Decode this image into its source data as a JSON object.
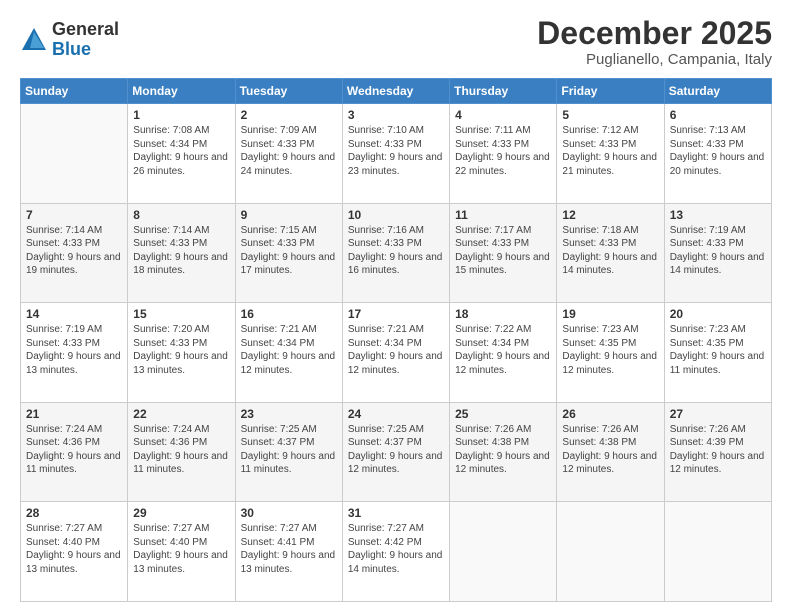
{
  "logo": {
    "general": "General",
    "blue": "Blue"
  },
  "header": {
    "month": "December 2025",
    "location": "Puglianello, Campania, Italy"
  },
  "weekdays": [
    "Sunday",
    "Monday",
    "Tuesday",
    "Wednesday",
    "Thursday",
    "Friday",
    "Saturday"
  ],
  "weeks": [
    [
      {
        "day": "",
        "sunrise": "",
        "sunset": "",
        "daylight": ""
      },
      {
        "day": "1",
        "sunrise": "Sunrise: 7:08 AM",
        "sunset": "Sunset: 4:34 PM",
        "daylight": "Daylight: 9 hours and 26 minutes."
      },
      {
        "day": "2",
        "sunrise": "Sunrise: 7:09 AM",
        "sunset": "Sunset: 4:33 PM",
        "daylight": "Daylight: 9 hours and 24 minutes."
      },
      {
        "day": "3",
        "sunrise": "Sunrise: 7:10 AM",
        "sunset": "Sunset: 4:33 PM",
        "daylight": "Daylight: 9 hours and 23 minutes."
      },
      {
        "day": "4",
        "sunrise": "Sunrise: 7:11 AM",
        "sunset": "Sunset: 4:33 PM",
        "daylight": "Daylight: 9 hours and 22 minutes."
      },
      {
        "day": "5",
        "sunrise": "Sunrise: 7:12 AM",
        "sunset": "Sunset: 4:33 PM",
        "daylight": "Daylight: 9 hours and 21 minutes."
      },
      {
        "day": "6",
        "sunrise": "Sunrise: 7:13 AM",
        "sunset": "Sunset: 4:33 PM",
        "daylight": "Daylight: 9 hours and 20 minutes."
      }
    ],
    [
      {
        "day": "7",
        "sunrise": "Sunrise: 7:14 AM",
        "sunset": "Sunset: 4:33 PM",
        "daylight": "Daylight: 9 hours and 19 minutes."
      },
      {
        "day": "8",
        "sunrise": "Sunrise: 7:14 AM",
        "sunset": "Sunset: 4:33 PM",
        "daylight": "Daylight: 9 hours and 18 minutes."
      },
      {
        "day": "9",
        "sunrise": "Sunrise: 7:15 AM",
        "sunset": "Sunset: 4:33 PM",
        "daylight": "Daylight: 9 hours and 17 minutes."
      },
      {
        "day": "10",
        "sunrise": "Sunrise: 7:16 AM",
        "sunset": "Sunset: 4:33 PM",
        "daylight": "Daylight: 9 hours and 16 minutes."
      },
      {
        "day": "11",
        "sunrise": "Sunrise: 7:17 AM",
        "sunset": "Sunset: 4:33 PM",
        "daylight": "Daylight: 9 hours and 15 minutes."
      },
      {
        "day": "12",
        "sunrise": "Sunrise: 7:18 AM",
        "sunset": "Sunset: 4:33 PM",
        "daylight": "Daylight: 9 hours and 14 minutes."
      },
      {
        "day": "13",
        "sunrise": "Sunrise: 7:19 AM",
        "sunset": "Sunset: 4:33 PM",
        "daylight": "Daylight: 9 hours and 14 minutes."
      }
    ],
    [
      {
        "day": "14",
        "sunrise": "Sunrise: 7:19 AM",
        "sunset": "Sunset: 4:33 PM",
        "daylight": "Daylight: 9 hours and 13 minutes."
      },
      {
        "day": "15",
        "sunrise": "Sunrise: 7:20 AM",
        "sunset": "Sunset: 4:33 PM",
        "daylight": "Daylight: 9 hours and 13 minutes."
      },
      {
        "day": "16",
        "sunrise": "Sunrise: 7:21 AM",
        "sunset": "Sunset: 4:34 PM",
        "daylight": "Daylight: 9 hours and 12 minutes."
      },
      {
        "day": "17",
        "sunrise": "Sunrise: 7:21 AM",
        "sunset": "Sunset: 4:34 PM",
        "daylight": "Daylight: 9 hours and 12 minutes."
      },
      {
        "day": "18",
        "sunrise": "Sunrise: 7:22 AM",
        "sunset": "Sunset: 4:34 PM",
        "daylight": "Daylight: 9 hours and 12 minutes."
      },
      {
        "day": "19",
        "sunrise": "Sunrise: 7:23 AM",
        "sunset": "Sunset: 4:35 PM",
        "daylight": "Daylight: 9 hours and 12 minutes."
      },
      {
        "day": "20",
        "sunrise": "Sunrise: 7:23 AM",
        "sunset": "Sunset: 4:35 PM",
        "daylight": "Daylight: 9 hours and 11 minutes."
      }
    ],
    [
      {
        "day": "21",
        "sunrise": "Sunrise: 7:24 AM",
        "sunset": "Sunset: 4:36 PM",
        "daylight": "Daylight: 9 hours and 11 minutes."
      },
      {
        "day": "22",
        "sunrise": "Sunrise: 7:24 AM",
        "sunset": "Sunset: 4:36 PM",
        "daylight": "Daylight: 9 hours and 11 minutes."
      },
      {
        "day": "23",
        "sunrise": "Sunrise: 7:25 AM",
        "sunset": "Sunset: 4:37 PM",
        "daylight": "Daylight: 9 hours and 11 minutes."
      },
      {
        "day": "24",
        "sunrise": "Sunrise: 7:25 AM",
        "sunset": "Sunset: 4:37 PM",
        "daylight": "Daylight: 9 hours and 12 minutes."
      },
      {
        "day": "25",
        "sunrise": "Sunrise: 7:26 AM",
        "sunset": "Sunset: 4:38 PM",
        "daylight": "Daylight: 9 hours and 12 minutes."
      },
      {
        "day": "26",
        "sunrise": "Sunrise: 7:26 AM",
        "sunset": "Sunset: 4:38 PM",
        "daylight": "Daylight: 9 hours and 12 minutes."
      },
      {
        "day": "27",
        "sunrise": "Sunrise: 7:26 AM",
        "sunset": "Sunset: 4:39 PM",
        "daylight": "Daylight: 9 hours and 12 minutes."
      }
    ],
    [
      {
        "day": "28",
        "sunrise": "Sunrise: 7:27 AM",
        "sunset": "Sunset: 4:40 PM",
        "daylight": "Daylight: 9 hours and 13 minutes."
      },
      {
        "day": "29",
        "sunrise": "Sunrise: 7:27 AM",
        "sunset": "Sunset: 4:40 PM",
        "daylight": "Daylight: 9 hours and 13 minutes."
      },
      {
        "day": "30",
        "sunrise": "Sunrise: 7:27 AM",
        "sunset": "Sunset: 4:41 PM",
        "daylight": "Daylight: 9 hours and 13 minutes."
      },
      {
        "day": "31",
        "sunrise": "Sunrise: 7:27 AM",
        "sunset": "Sunset: 4:42 PM",
        "daylight": "Daylight: 9 hours and 14 minutes."
      },
      {
        "day": "",
        "sunrise": "",
        "sunset": "",
        "daylight": ""
      },
      {
        "day": "",
        "sunrise": "",
        "sunset": "",
        "daylight": ""
      },
      {
        "day": "",
        "sunrise": "",
        "sunset": "",
        "daylight": ""
      }
    ]
  ]
}
